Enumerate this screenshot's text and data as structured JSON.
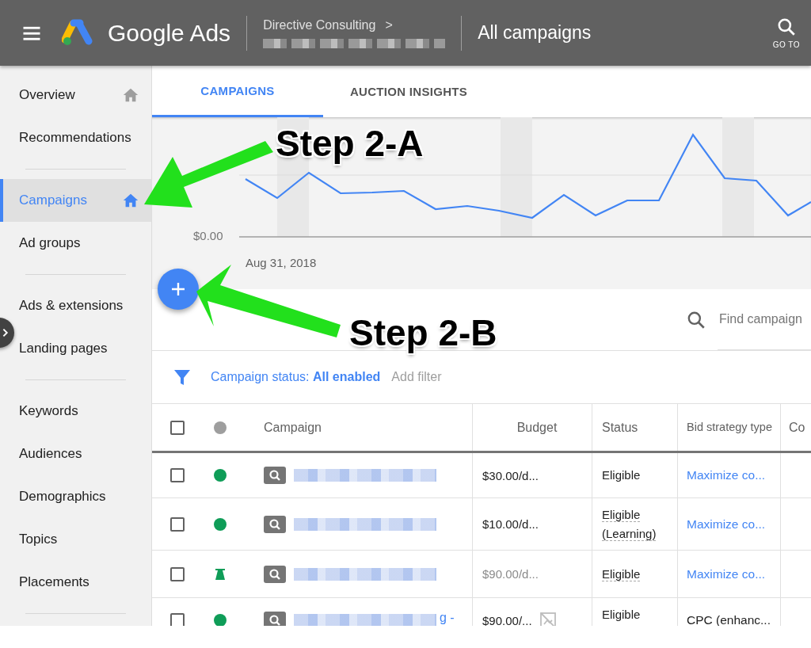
{
  "header": {
    "product": "Google Ads",
    "account": "Directive Consulting",
    "account_chevron": ">",
    "page_title": "All campaigns",
    "goto_label": "GO TO"
  },
  "sidebar": {
    "groups": [
      [
        {
          "label": "Overview",
          "selected": false,
          "home": true
        },
        {
          "label": "Recommendations",
          "selected": false,
          "home": false
        }
      ],
      [
        {
          "label": "Campaigns",
          "selected": true,
          "home": true
        },
        {
          "label": "Ad groups",
          "selected": false,
          "home": false
        }
      ],
      [
        {
          "label": "Ads & extensions",
          "selected": false,
          "home": false
        },
        {
          "label": "Landing pages",
          "selected": false,
          "home": false
        }
      ],
      [
        {
          "label": "Keywords",
          "selected": false,
          "home": false
        },
        {
          "label": "Audiences",
          "selected": false,
          "home": false
        },
        {
          "label": "Demographics",
          "selected": false,
          "home": false
        },
        {
          "label": "Topics",
          "selected": false,
          "home": false
        },
        {
          "label": "Placements",
          "selected": false,
          "home": false
        }
      ]
    ]
  },
  "tabs": [
    {
      "label": "CAMPAIGNS",
      "selected": true
    },
    {
      "label": "AUCTION INSIGHTS",
      "selected": false
    }
  ],
  "chart": {
    "y_label": "$0.00",
    "x_label": "Aug 31, 2018"
  },
  "search": {
    "placeholder": "Find campaign"
  },
  "filter": {
    "label": "Campaign status: **All enabled**",
    "add": "Add filter"
  },
  "table": {
    "header_checked": false,
    "columns": [
      "Campaign",
      "Budget",
      "Status",
      "Bid strategy type",
      "Co"
    ],
    "rows": [
      {
        "checked": false,
        "kind": "dot",
        "budget": "$30.00/d...",
        "budget_muted": false,
        "budget_icon": false,
        "status": [
          {
            "text": "Eligible",
            "underlined": false
          }
        ],
        "bid": "Maximize co...",
        "bid_link": true,
        "name_fragment": null
      },
      {
        "checked": false,
        "kind": "dot",
        "budget": "$10.00/d...",
        "budget_muted": false,
        "budget_icon": false,
        "status": [
          {
            "text": "Eligible",
            "underlined": true
          },
          {
            "text": "(Learning)",
            "underlined": true
          }
        ],
        "bid": "Maximize co...",
        "bid_link": true,
        "name_fragment": null
      },
      {
        "checked": false,
        "kind": "experiment",
        "budget": "$90.00/d...",
        "budget_muted": true,
        "budget_icon": false,
        "status": [
          {
            "text": "Eligible",
            "underlined": true
          }
        ],
        "bid": "Maximize co...",
        "bid_link": true,
        "name_fragment": null
      },
      {
        "checked": false,
        "kind": "dot",
        "budget": "$90.00/...",
        "budget_muted": false,
        "budget_icon": true,
        "status": [
          {
            "text": "Eligible",
            "underlined": false
          }
        ],
        "bid": "CPC (enhanc...",
        "bid_link": false,
        "name_fragment": "g -"
      }
    ]
  },
  "annotations": [
    {
      "text": "Step 2-A",
      "kind": "a"
    },
    {
      "text": "Step 2-B",
      "kind": "b"
    }
  ]
}
